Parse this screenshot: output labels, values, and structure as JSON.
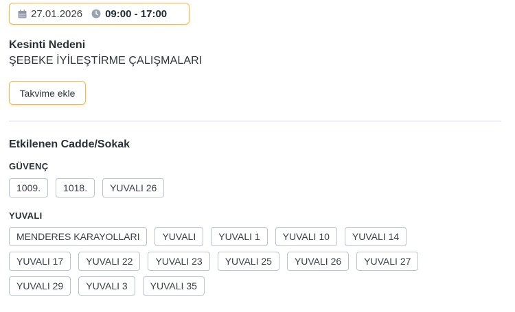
{
  "outage": {
    "date": "27.01.2026",
    "time": "09:00 - 17:00",
    "cause_title": "Kesinti Nedeni",
    "cause_value": "ŞEBEKE İYİLEŞTİRME ÇALIŞMALARI",
    "calendar_button": "Takvime ekle",
    "icons": [
      "calendar-icon",
      "clock-icon"
    ],
    "accent_color": "#f2b84b"
  },
  "streets": {
    "title": "Etkilenen Cadde/Sokak",
    "groups": [
      {
        "name": "GÜVENÇ",
        "rows": [
          [
            "1009.",
            "1018.",
            "YUVALI 26"
          ]
        ]
      },
      {
        "name": "YUVALI",
        "rows": [
          [
            "MENDERES KARAYOLLARI",
            "YUVALI",
            "YUVALI 1",
            "YUVALI 10",
            "YUVALI 14"
          ],
          [
            "YUVALI 17",
            "YUVALI 22",
            "YUVALI 23",
            "YUVALI 25",
            "YUVALI 26",
            "YUVALI 27"
          ],
          [
            "YUVALI 29",
            "YUVALI 3",
            "YUVALI 35"
          ]
        ]
      }
    ]
  }
}
